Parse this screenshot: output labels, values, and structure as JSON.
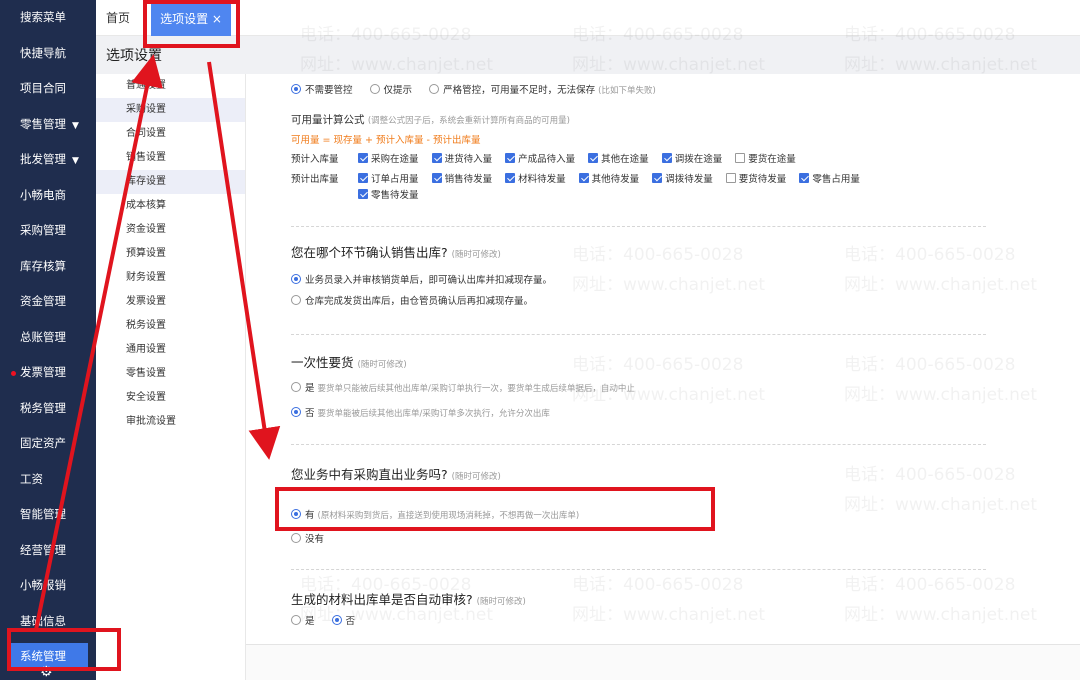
{
  "leftnav": {
    "items": [
      {
        "label": "搜索菜单"
      },
      {
        "label": "快捷导航"
      },
      {
        "label": "项目合同"
      },
      {
        "label": "零售管理",
        "caret": "▼"
      },
      {
        "label": "批发管理",
        "caret": "▼"
      },
      {
        "label": "小畅电商"
      },
      {
        "label": "采购管理"
      },
      {
        "label": "库存核算"
      },
      {
        "label": "资金管理"
      },
      {
        "label": "总账管理"
      },
      {
        "label": "发票管理"
      },
      {
        "label": "税务管理"
      },
      {
        "label": "固定资产"
      },
      {
        "label": "工资"
      },
      {
        "label": "智能管理"
      },
      {
        "label": "经营管理"
      },
      {
        "label": "小畅报销"
      },
      {
        "label": "基础信息"
      },
      {
        "label": "系统管理"
      }
    ]
  },
  "tabs": {
    "home": "首页",
    "current": "选项设置 ×"
  },
  "page_title": "选项设置",
  "subnav": {
    "items": [
      "普通设置",
      "采购设置",
      "合同设置",
      "销售设置",
      "库存设置",
      "成本核算",
      "资金设置",
      "预算设置",
      "财务设置",
      "发票设置",
      "税务设置",
      "通用设置",
      "零售设置",
      "安全设置",
      "审批流设置"
    ]
  },
  "control": {
    "opt1": "不需要管控",
    "opt2": "仅提示",
    "opt3": "严格管控，可用量不足时，无法保存",
    "opt3_hint": "(比如下单失败)"
  },
  "formula": {
    "title": "可用量计算公式",
    "hint": "(调整公式因子后，系统会重新计算所有商品的可用量)",
    "expr": "可用量 = 现存量 + 预计入库量 - 预计出库量",
    "in_label": "预计入库量",
    "in_items": [
      "采购在途量",
      "进货待入量",
      "产成品待入量",
      "其他在途量",
      "调拨在途量",
      "要货在途量"
    ],
    "out_label": "预计出库量",
    "out_items": [
      "订单占用量",
      "销售待发量",
      "材料待发量",
      "其他待发量",
      "调拨待发量",
      "要货待发量",
      "零售占用量",
      "零售待发量"
    ]
  },
  "sec_sale": {
    "title": "您在哪个环节确认销售出库?",
    "hint": "(随时可修改)",
    "opt1": "业务员录入并审核销货单后，即可确认出库并扣减现存量。",
    "opt2": "仓库完成发货出库后，由仓管员确认后再扣减现存量。"
  },
  "sec_once": {
    "title": "一次性要货",
    "hint": "(随时可修改)",
    "opt1": "是",
    "opt1_hint": "要货单只能被后续其他出库单/采购订单执行一次，要货单生成后续单据后，自动中止",
    "opt2": "否",
    "opt2_hint": "要货单能被后续其他出库单/采购订单多次执行，允许分次出库"
  },
  "sec_direct": {
    "title": "您业务中有采购直出业务吗?",
    "hint": "(随时可修改)",
    "opt1": "有",
    "opt1_hint": "(原材料采购到货后，直接送到使用现场消耗掉，不想再做一次出库单)",
    "opt2": "没有"
  },
  "sec_audit": {
    "title": "生成的材料出库单是否自动审核?",
    "hint": "(随时可修改)",
    "opt1": "是",
    "opt2": "否"
  },
  "watermark": {
    "phone": "电话：400-665-0028",
    "site": "网址：www.chanjet.net"
  },
  "colors": {
    "nav_bg": "#1f2d4e",
    "accent": "#3f79e8",
    "annot": "#e0141e",
    "formula": "#f07b1a"
  }
}
